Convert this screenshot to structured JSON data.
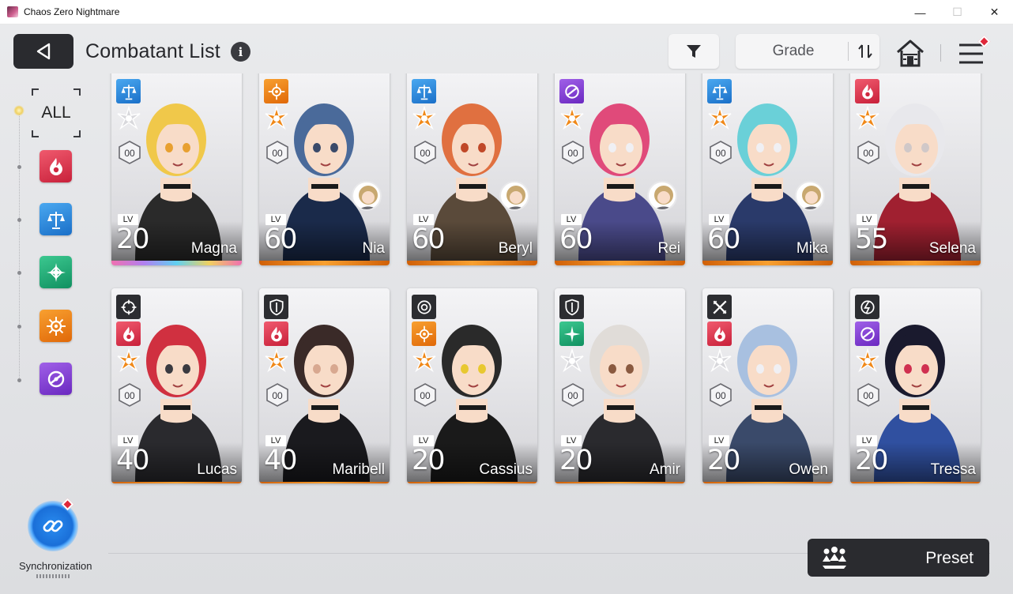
{
  "window": {
    "title": "Chaos Zero Nightmare",
    "minimize": "—",
    "maximize": "☐",
    "close": "✕"
  },
  "header": {
    "title": "Combatant List",
    "info": "i",
    "sort_label": "Grade"
  },
  "sidebar": {
    "all_label": "ALL",
    "filters": [
      "passion",
      "justice",
      "order",
      "instinct",
      "void"
    ]
  },
  "combatants": [
    {
      "name": "Magna",
      "level": "20",
      "attribute": "justice",
      "class": "striker",
      "rarity": "rainbow"
    },
    {
      "name": "Nia",
      "level": "60",
      "attribute": "instinct",
      "class": "vanguard",
      "rarity": "gold",
      "partner": true
    },
    {
      "name": "Beryl",
      "level": "60",
      "attribute": "justice",
      "class": "vanguard",
      "rarity": "gold",
      "partner": true
    },
    {
      "name": "Rei",
      "level": "60",
      "attribute": "void",
      "class": "vanguard",
      "rarity": "gold",
      "partner": true
    },
    {
      "name": "Mika",
      "level": "60",
      "attribute": "justice",
      "class": "vanguard",
      "rarity": "gold",
      "partner": true
    },
    {
      "name": "Selena",
      "level": "55",
      "attribute": "passion",
      "class": "vanguard",
      "rarity": "gold"
    },
    {
      "name": "Lucas",
      "level": "40",
      "attribute": "passion",
      "class": "vanguard",
      "rarity": "gold",
      "role": "hunter"
    },
    {
      "name": "Maribell",
      "level": "40",
      "attribute": "passion",
      "class": "vanguard",
      "rarity": "gold",
      "role": "guardian"
    },
    {
      "name": "Cassius",
      "level": "20",
      "attribute": "instinct",
      "class": "vanguard",
      "rarity": "gold",
      "role": "controller"
    },
    {
      "name": "Amir",
      "level": "20",
      "attribute": "order",
      "class": "striker",
      "rarity": "gold",
      "role": "guardian"
    },
    {
      "name": "Owen",
      "level": "20",
      "attribute": "passion",
      "class": "striker",
      "rarity": "gold",
      "role": "striker"
    },
    {
      "name": "Tressa",
      "level": "20",
      "attribute": "void",
      "class": "vanguard",
      "rarity": "gold",
      "role": "ranger"
    }
  ],
  "card_labels": {
    "lv": "LV",
    "grade_badge": "00"
  },
  "footer": {
    "sync_label": "Synchronization",
    "preset_label": "Preset"
  },
  "colors": {
    "passion": "#e0304a",
    "justice": "#2a8ae0",
    "order": "#20b078",
    "instinct": "#f08818",
    "void": "#8a44d8",
    "accent_dark": "#2a2b2f",
    "notification": "#e0283a"
  }
}
